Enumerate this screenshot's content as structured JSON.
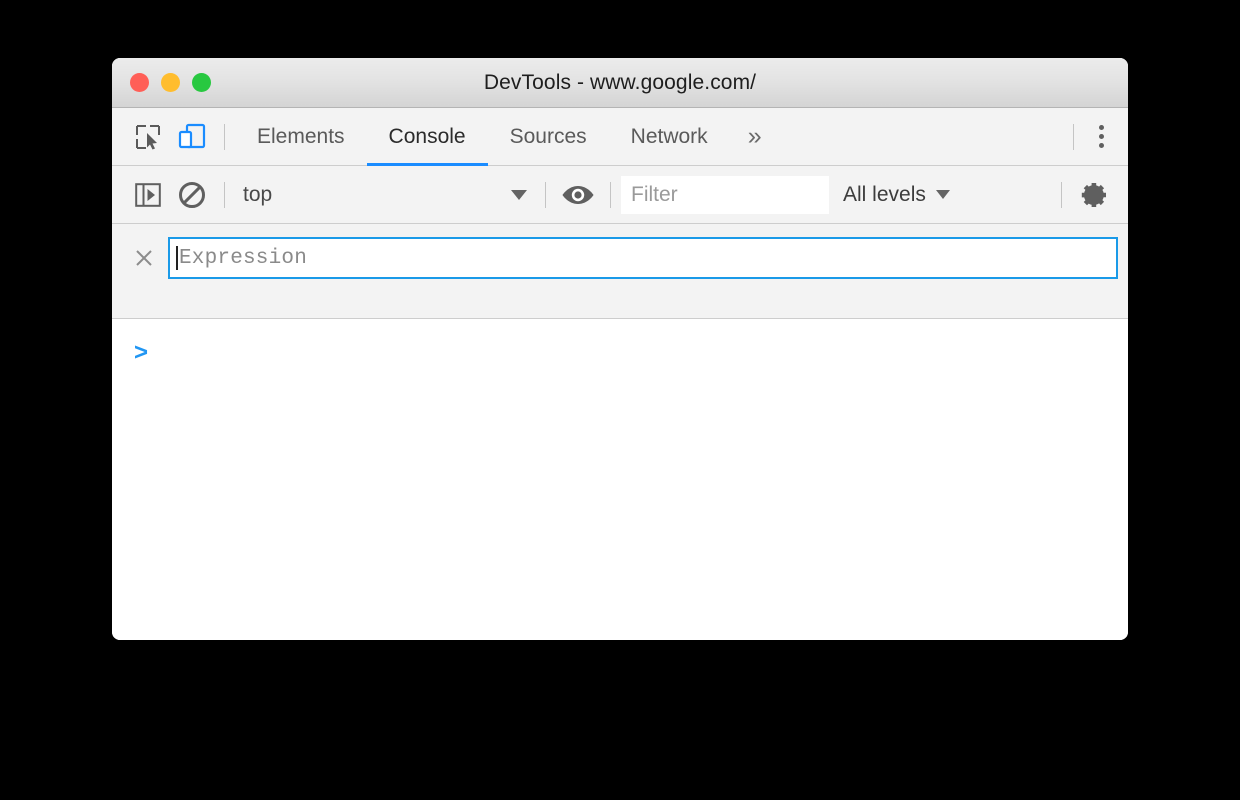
{
  "window": {
    "title": "DevTools - www.google.com/",
    "traffic_lights": [
      {
        "name": "close",
        "color": "#ff5f57"
      },
      {
        "name": "minimize",
        "color": "#ffbd2e"
      },
      {
        "name": "zoom",
        "color": "#28c840"
      }
    ]
  },
  "tabbar": {
    "inspect_icon": "inspect-element-icon",
    "device_toolbar_icon": "device-toolbar-icon",
    "device_toolbar_active_color": "#1a8cff",
    "tabs": [
      {
        "label": "Elements",
        "active": false
      },
      {
        "label": "Console",
        "active": true
      },
      {
        "label": "Sources",
        "active": false
      },
      {
        "label": "Network",
        "active": false
      }
    ],
    "more_tabs_label": "»",
    "active_underline_color": "#1a8cff",
    "main_menu_icon": "vertical-dots-icon"
  },
  "console_toolbar": {
    "sidebar_toggle_icon": "show-console-sidebar-icon",
    "clear_console_icon": "clear-console-icon",
    "context": {
      "value": "top",
      "caret_icon": "chevron-down-icon"
    },
    "live_expression_icon": "eye-icon",
    "filter": {
      "value": "",
      "placeholder": "Filter"
    },
    "levels": {
      "value": "All levels",
      "caret_icon": "chevron-down-icon"
    },
    "settings_icon": "gear-icon"
  },
  "live_expression": {
    "close_icon": "close-icon",
    "value": "",
    "placeholder": "Expression",
    "focus_border_color": "#1a9ae8",
    "has_text_cursor": true
  },
  "console_output": {
    "prompt_symbol": ">",
    "prompt_color": "#2196f3",
    "messages": []
  }
}
